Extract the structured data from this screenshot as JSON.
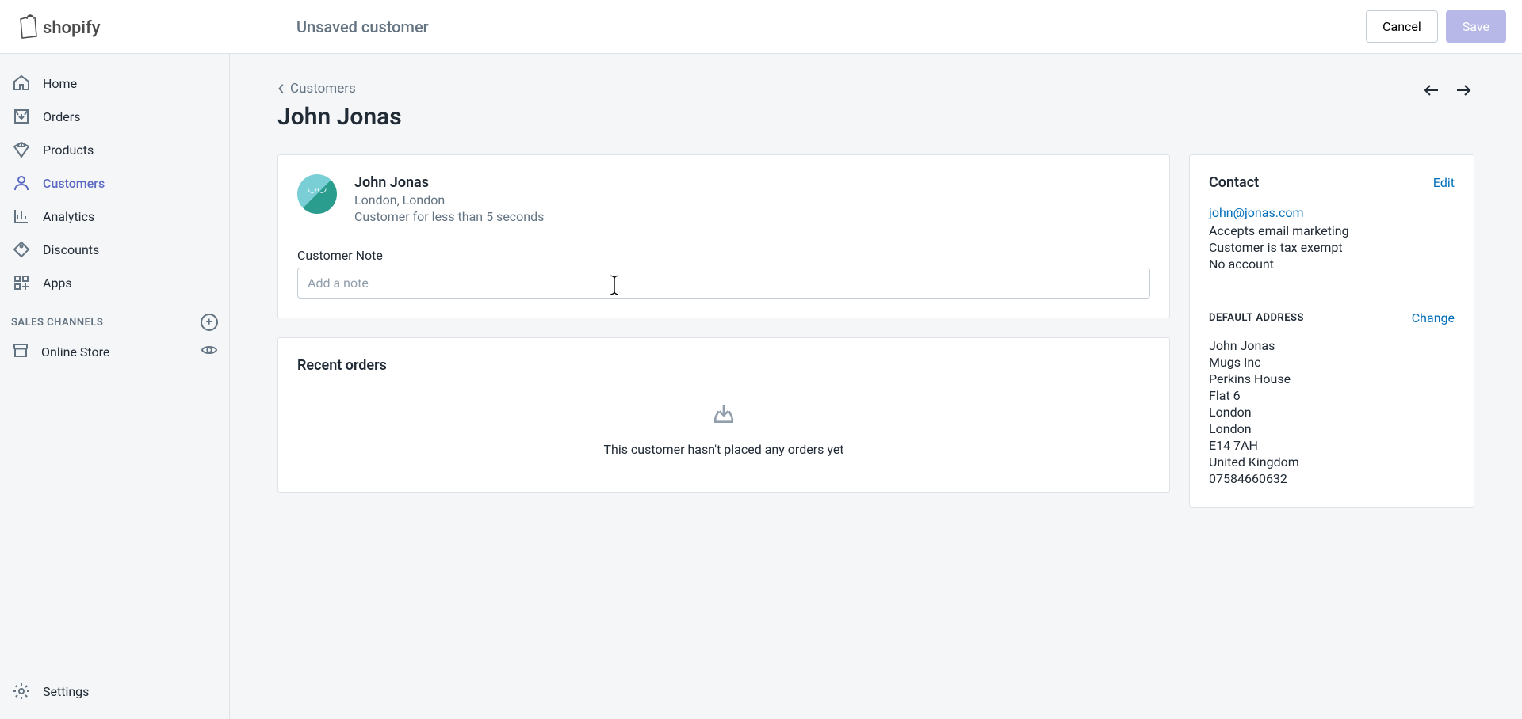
{
  "topbar": {
    "status": "Unsaved customer",
    "cancel": "Cancel",
    "save": "Save"
  },
  "sidebar": {
    "home": "Home",
    "orders": "Orders",
    "products": "Products",
    "customers": "Customers",
    "analytics": "Analytics",
    "discounts": "Discounts",
    "apps": "Apps",
    "sales_channels_header": "SALES CHANNELS",
    "online_store": "Online Store",
    "settings": "Settings"
  },
  "breadcrumb": {
    "label": "Customers"
  },
  "page": {
    "title": "John Jonas"
  },
  "customer_card": {
    "name": "John Jonas",
    "location": "London, London",
    "duration": "Customer for less than 5 seconds",
    "note_label": "Customer Note",
    "note_placeholder": "Add a note"
  },
  "orders_card": {
    "title": "Recent orders",
    "empty_text": "This customer hasn't placed any orders yet"
  },
  "contact_card": {
    "title": "Contact",
    "edit": "Edit",
    "email": "john@jonas.com",
    "marketing": "Accepts email marketing",
    "tax": "Customer is tax exempt",
    "account": "No account",
    "default_address_header": "DEFAULT ADDRESS",
    "change": "Change",
    "addr_name": "John Jonas",
    "addr_company": "Mugs Inc",
    "addr_line1": "Perkins House",
    "addr_line2": "Flat 6",
    "addr_city1": "London",
    "addr_city2": "London",
    "addr_postcode": "E14 7AH",
    "addr_country": "United Kingdom",
    "addr_phone": "07584660632"
  }
}
